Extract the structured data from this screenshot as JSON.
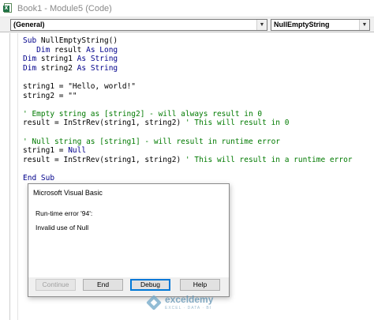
{
  "window": {
    "title": "Book1 - Module5 (Code)"
  },
  "combos": {
    "object": "(General)",
    "procedure": "NullEmptyString"
  },
  "code_lines": [
    {
      "segments": [
        {
          "t": "kw",
          "s": "Sub "
        },
        {
          "t": "tx",
          "s": "NullEmptyString()"
        }
      ]
    },
    {
      "segments": [
        {
          "t": "kw",
          "s": "   Dim "
        },
        {
          "t": "tx",
          "s": "result "
        },
        {
          "t": "kw",
          "s": "As Long"
        }
      ]
    },
    {
      "segments": [
        {
          "t": "kw",
          "s": "Dim "
        },
        {
          "t": "tx",
          "s": "string1 "
        },
        {
          "t": "kw",
          "s": "As String"
        }
      ]
    },
    {
      "segments": [
        {
          "t": "kw",
          "s": "Dim "
        },
        {
          "t": "tx",
          "s": "string2 "
        },
        {
          "t": "kw",
          "s": "As String"
        }
      ]
    },
    {
      "segments": []
    },
    {
      "segments": [
        {
          "t": "tx",
          "s": "string1 = \"Hello, world!\""
        }
      ]
    },
    {
      "segments": [
        {
          "t": "tx",
          "s": "string2 = \"\""
        }
      ]
    },
    {
      "segments": []
    },
    {
      "segments": [
        {
          "t": "cm",
          "s": "' Empty string as [string2] - will always result in 0"
        }
      ]
    },
    {
      "segments": [
        {
          "t": "tx",
          "s": "result = InStrRev(string1, string2) "
        },
        {
          "t": "cm",
          "s": "' This will result in 0"
        }
      ]
    },
    {
      "segments": []
    },
    {
      "segments": [
        {
          "t": "cm",
          "s": "' Null string as [string1] - will result in runtime error"
        }
      ]
    },
    {
      "segments": [
        {
          "t": "tx",
          "s": "string1 = "
        },
        {
          "t": "kw",
          "s": "Null"
        }
      ]
    },
    {
      "segments": [
        {
          "t": "tx",
          "s": "result = InStrRev(string1, string2) "
        },
        {
          "t": "cm",
          "s": "' This will result in a runtime error"
        }
      ]
    },
    {
      "segments": []
    },
    {
      "segments": [
        {
          "t": "kw",
          "s": "End Sub"
        }
      ]
    }
  ],
  "dialog": {
    "title": "Microsoft Visual Basic",
    "message_line1": "Run-time error '94':",
    "message_line2": "Invalid use of Null",
    "buttons": {
      "continue": "Continue",
      "end": "End",
      "debug": "Debug",
      "help": "Help"
    }
  },
  "watermark": {
    "name": "exceldemy",
    "tagline": "EXCEL · DATA · BI"
  },
  "icons": {
    "app": "excel-icon",
    "dropdown": "chevron-down-icon",
    "watermark": "exceldemy-logo-icon"
  },
  "colors": {
    "keyword": "#00008b",
    "comment": "#007a00",
    "text": "#000000",
    "default_button_border": "#0078d7"
  }
}
